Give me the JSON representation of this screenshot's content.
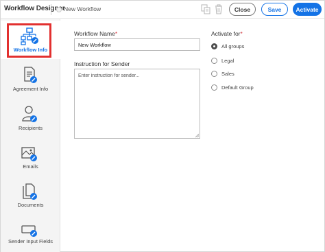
{
  "header": {
    "app_title": "Workflow Designer",
    "workflow_name": "New Workflow",
    "close_label": "Close",
    "save_label": "Save",
    "activate_label": "Activate",
    "accent_color": "#1473e6"
  },
  "sidebar": {
    "items": [
      {
        "label": "Workflow Info",
        "icon": "workflow-info-icon",
        "active": true
      },
      {
        "label": "Agreement Info",
        "icon": "agreement-info-icon",
        "active": false
      },
      {
        "label": "Recipients",
        "icon": "recipients-icon",
        "active": false
      },
      {
        "label": "Emails",
        "icon": "emails-icon",
        "active": false
      },
      {
        "label": "Documents",
        "icon": "documents-icon",
        "active": false
      },
      {
        "label": "Sender Input Fields",
        "icon": "sender-input-fields-icon",
        "active": false
      }
    ],
    "highlight_color": "#e2302f"
  },
  "form": {
    "workflow_name_label": "Workflow Name",
    "workflow_name_value": "New Workflow",
    "instruction_label": "Instruction for Sender",
    "instruction_placeholder": "Enter instruction for sender...",
    "required_mark": "*"
  },
  "activate_for": {
    "label": "Activate for",
    "options": [
      {
        "label": "All groups",
        "checked": true
      },
      {
        "label": "Legal",
        "checked": false
      },
      {
        "label": "Sales",
        "checked": false
      },
      {
        "label": "Default Group",
        "checked": false
      }
    ]
  }
}
